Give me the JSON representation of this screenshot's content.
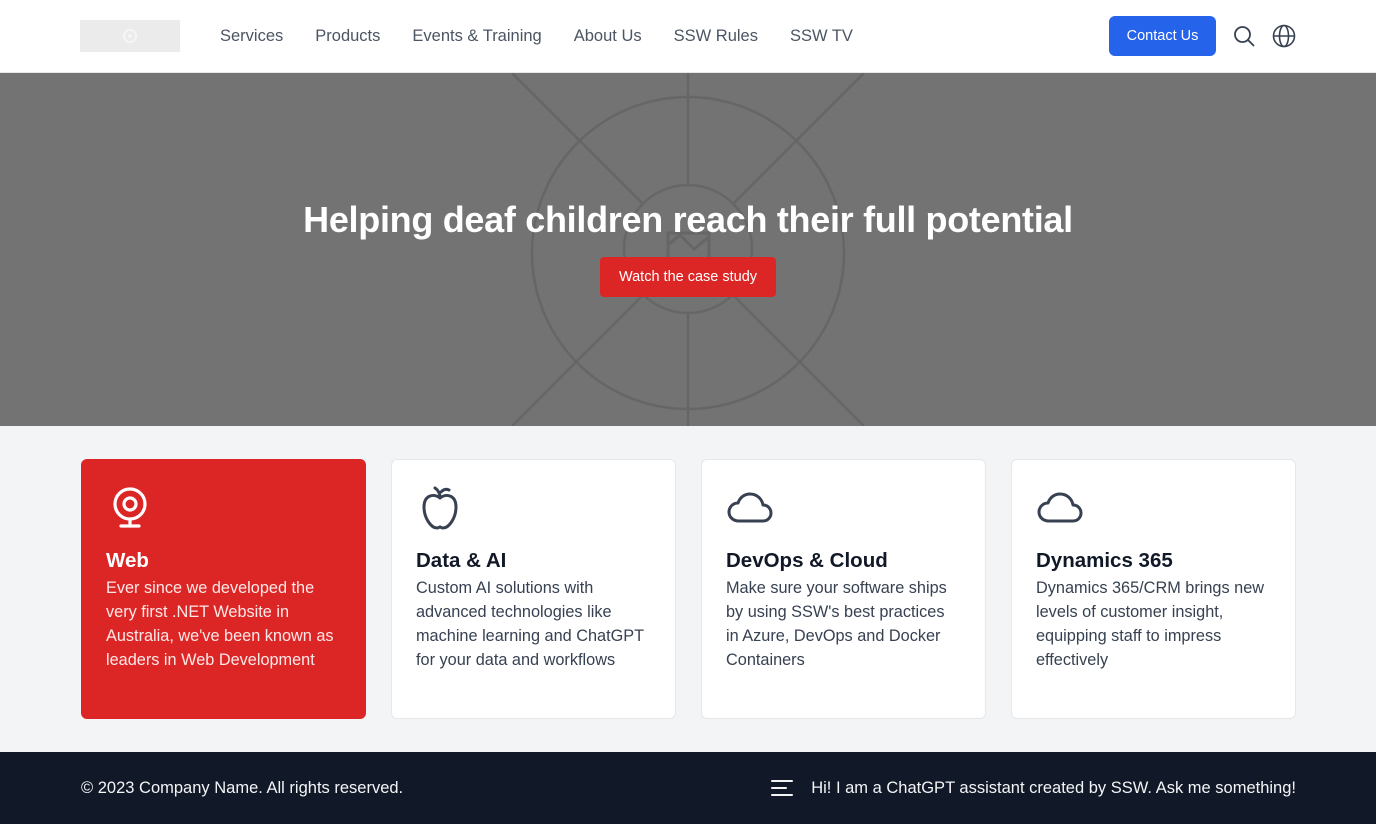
{
  "header": {
    "logo_alt": "logo",
    "nav": [
      {
        "label": "Services"
      },
      {
        "label": "Products"
      },
      {
        "label": "Events & Training"
      },
      {
        "label": "About Us"
      },
      {
        "label": "SSW Rules"
      },
      {
        "label": "SSW TV"
      }
    ],
    "contact_label": "Contact Us",
    "search_icon": "search-icon",
    "language_icon": "globe-icon"
  },
  "hero": {
    "title": "Helping deaf children reach their full potential",
    "cta_label": "Watch the case study"
  },
  "cards": [
    {
      "icon": "webcam-icon",
      "title": "Web",
      "description": "Ever since we developed the very first .NET Website in Australia, we've been known as leaders in Web Development",
      "active": true
    },
    {
      "icon": "apple-icon",
      "title": "Data & AI",
      "description": "Custom AI solutions with advanced technologies like machine learning and ChatGPT for your data and workflows",
      "active": false
    },
    {
      "icon": "cloud-icon",
      "title": "DevOps & Cloud",
      "description": "Make sure your software ships by using SSW's best practices in Azure, DevOps and Docker Containers",
      "active": false
    },
    {
      "icon": "cloud-icon",
      "title": "Dynamics 365",
      "description": "Dynamics 365/CRM brings new levels of customer insight, equipping staff to impress effectively",
      "active": false
    }
  ],
  "footer": {
    "copyright": "© 2023 Company Name. All rights reserved.",
    "chat_prompt": "Hi! I am a ChatGPT assistant created by SSW. Ask me something!",
    "chat_icon": "menu-icon"
  },
  "colors": {
    "primary_blue": "#2563eb",
    "accent_red": "#dc2626",
    "hero_gray": "#737373",
    "footer_dark": "#111827"
  }
}
